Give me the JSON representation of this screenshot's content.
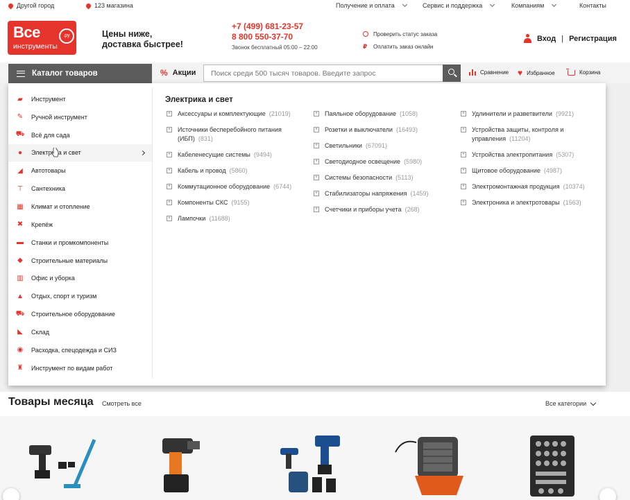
{
  "topbar": {
    "city": "Другой город",
    "stores": "123 магазина",
    "delivery": "Получение и оплата",
    "service": "Сервис и поддержка",
    "companies": "Компаниям",
    "contacts": "Контакты"
  },
  "logo": {
    "line1": "Все",
    "line2": "инструменты",
    "badge": ".ру"
  },
  "slogan": {
    "line1": "Цены ниже,",
    "line2": "доставка быстрее!"
  },
  "phones": {
    "phone1": "+7 (499) 681-23-57",
    "phone2": "8 800 550-37-70",
    "hours": "Звонок бесплатный 05:00 – 22:00"
  },
  "links": {
    "check_order": "Проверить статус заказа",
    "pay_online": "Оплатить заказ онлайн"
  },
  "auth": {
    "login": "Вход",
    "separator": "|",
    "register": "Регистрация"
  },
  "nav": {
    "catalog": "Каталог товаров",
    "promo": "Акции",
    "search_placeholder": "Поиск среди 500 тысяч товаров. Введите запрос",
    "compare": "Сравнение",
    "favorites": "Избранное",
    "cart": "Корзина"
  },
  "menu": [
    {
      "label": "Инструмент",
      "icon": "drill-icon"
    },
    {
      "label": "Ручной инструмент",
      "icon": "screwdriver-icon"
    },
    {
      "label": "Всё для сада",
      "icon": "lawnmower-icon"
    },
    {
      "label": "Электрика и свет",
      "icon": "lightbulb-icon",
      "active": true
    },
    {
      "label": "Автотовары",
      "icon": "car-jack-icon"
    },
    {
      "label": "Сантехника",
      "icon": "faucet-icon"
    },
    {
      "label": "Климат и отопление",
      "icon": "heater-icon"
    },
    {
      "label": "Крепёж",
      "icon": "bolt-icon"
    },
    {
      "label": "Станки и промкомпоненты",
      "icon": "machine-icon"
    },
    {
      "label": "Строительные материалы",
      "icon": "trowel-icon"
    },
    {
      "label": "Офис и уборка",
      "icon": "office-icon"
    },
    {
      "label": "Отдых, спорт и туризм",
      "icon": "tent-icon"
    },
    {
      "label": "Строительное оборудование",
      "icon": "concrete-mixer-icon"
    },
    {
      "label": "Склад",
      "icon": "hand-truck-icon"
    },
    {
      "label": "Расходка, спецодежда и СИЗ",
      "icon": "disc-icon"
    },
    {
      "label": "Инструмент по видам работ",
      "icon": "hydrant-icon"
    }
  ],
  "submenu": {
    "title": "Электрика и свет",
    "columns": [
      [
        {
          "label": "Аксессуары и комплектующие",
          "count": "(21019)"
        },
        {
          "label": "Источники бесперебойного питания (ИБП)",
          "count": "(831)"
        },
        {
          "label": "Кабеленесущие системы",
          "count": "(9494)"
        },
        {
          "label": "Кабель и провод",
          "count": "(5860)"
        },
        {
          "label": "Коммутационное оборудование",
          "count": "(6744)"
        },
        {
          "label": "Компоненты СКС",
          "count": "(9155)"
        },
        {
          "label": "Лампочки",
          "count": "(11688)"
        }
      ],
      [
        {
          "label": "Паяльное оборудование",
          "count": "(1058)"
        },
        {
          "label": "Розетки и выключатели",
          "count": "(16493)"
        },
        {
          "label": "Светильники",
          "count": "(67091)"
        },
        {
          "label": "Светодиодное освещение",
          "count": "(5980)"
        },
        {
          "label": "Системы безопасности",
          "count": "(5113)"
        },
        {
          "label": "Стабилизаторы напряжения",
          "count": "(1459)"
        },
        {
          "label": "Счетчики и приборы учета",
          "count": "(268)"
        }
      ],
      [
        {
          "label": "Удлинители и разветвители",
          "count": "(9921)"
        },
        {
          "label": "Устройства защиты, контроля и управления",
          "count": "(11204)"
        },
        {
          "label": "Устройства электропитания",
          "count": "(5307)"
        },
        {
          "label": "Щитовое оборудование",
          "count": "(4987)"
        },
        {
          "label": "Электромонтажная продукция",
          "count": "(10374)"
        },
        {
          "label": "Электроника и электротовары",
          "count": "(1563)"
        }
      ]
    ]
  },
  "section": {
    "title": "Товары месяца",
    "see_all": "Смотреть все",
    "all_categories": "Все категории"
  },
  "products": [
    {
      "icon": "drill-vacuum-set-icon"
    },
    {
      "icon": "cordless-drill-icon"
    },
    {
      "icon": "screwdriver-kit-icon"
    },
    {
      "icon": "fan-heater-icon"
    },
    {
      "icon": "socket-set-icon"
    }
  ],
  "colors": {
    "brand": "#e4342c",
    "dark": "#5c5c5c"
  }
}
